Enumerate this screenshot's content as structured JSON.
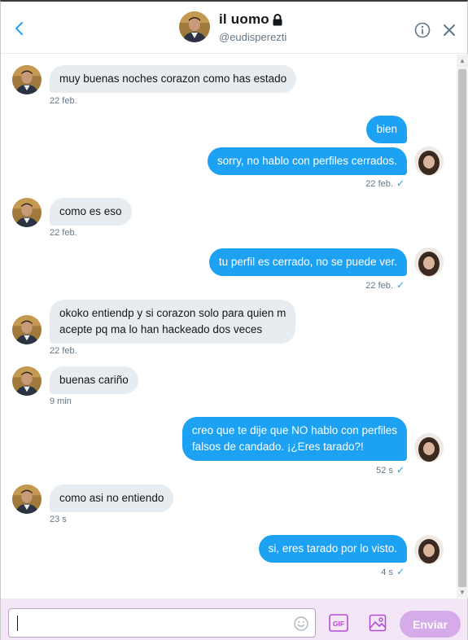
{
  "header": {
    "name": "il uomo",
    "handle": "@eudisperezti",
    "icons": {
      "back": "chevron-left-icon",
      "lock": "lock-icon",
      "info": "info-icon",
      "close": "close-icon"
    }
  },
  "messages": [
    {
      "direction": "in",
      "text": "muy buenas noches corazon como has estado",
      "time": "22 feb."
    },
    {
      "direction": "out",
      "text": "bien"
    },
    {
      "direction": "out",
      "text": "sorry, no hablo con perfiles cerrados.",
      "time": "22 feb."
    },
    {
      "direction": "in",
      "text": "como es eso",
      "time": "22 feb."
    },
    {
      "direction": "out",
      "text": "tu perfil es cerrado, no se puede ver.",
      "time": "22 feb."
    },
    {
      "direction": "in",
      "lines": [
        "okoko entiendp y si corazon solo para quien m",
        "acepte pq ma lo han hackeado dos veces"
      ],
      "time": "22 feb."
    },
    {
      "direction": "in",
      "text": "buenas cariño",
      "time": "9 min"
    },
    {
      "direction": "out",
      "lines": [
        "creo que te dije que NO hablo con perfiles",
        "falsos de candado. ¡¿Eres tarado?!"
      ],
      "time": "52 s"
    },
    {
      "direction": "in",
      "text": "como asi no entiendo",
      "time": "23 s"
    },
    {
      "direction": "out",
      "text": "si, eres tarado por lo visto.",
      "time": "4 s"
    }
  ],
  "composer": {
    "send_label": "Enviar",
    "gif_label": "GIF",
    "icons": {
      "emoji": "emoji-icon",
      "gif": "gif-icon",
      "image": "image-icon"
    }
  },
  "colors": {
    "outgoing_bubble": "#1da1f2",
    "incoming_bubble": "#e6ecf0",
    "send_button": "#d4a5e8",
    "composer_bg": "#f2e6f7"
  }
}
